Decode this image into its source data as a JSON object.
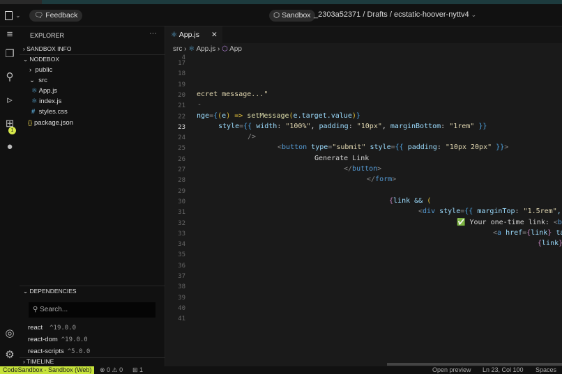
{
  "header": {
    "feedback": "Feedback",
    "sandbox": "Sandbox",
    "path": "_2303a52371 / Drafts / ecstatic-hoover-nyttv4"
  },
  "activity": {
    "badge": "1"
  },
  "explorer": {
    "title": "EXPLORER",
    "more": "···",
    "sandbox_info": "SANDBOX INFO",
    "nodebox": "NODEBOX",
    "tree": [
      {
        "label": "public",
        "kind": "folder"
      },
      {
        "label": "src",
        "kind": "folder-open"
      },
      {
        "label": "App.js",
        "kind": "react"
      },
      {
        "label": "index.js",
        "kind": "react"
      },
      {
        "label": "styles.css",
        "kind": "css"
      },
      {
        "label": "package.json",
        "kind": "json"
      }
    ],
    "dependencies": "DEPENDENCIES",
    "search_placeholder": "Search...",
    "deps": [
      {
        "name": "react",
        "version": "^19.0.0"
      },
      {
        "name": "react-dom",
        "version": "^19.0.0"
      },
      {
        "name": "react-scripts",
        "version": "^5.0.0"
      }
    ],
    "timeline": "TIMELINE"
  },
  "editor": {
    "tab": "App.js",
    "breadcrumbs": [
      "src",
      "App.js",
      "App"
    ],
    "line_numbers": [
      "4",
      "17",
      "18",
      "19",
      "20",
      "21",
      "22",
      "23",
      "24",
      "25",
      "26",
      "27",
      "28",
      "29",
      "30",
      "31",
      "32",
      "33",
      "34",
      "35",
      "36",
      "37",
      "38",
      "39",
      "40",
      "41"
    ],
    "current_line": "23",
    "lines": [
      {
        "ln": "20",
        "tokens": [
          {
            "t": "ecret message...\"",
            "c": "str"
          }
        ]
      },
      {
        "ln": "21",
        "tokens": [
          {
            "t": "-",
            "c": "punc"
          }
        ]
      },
      {
        "ln": "22",
        "tokens": [
          {
            "t": "nge",
            "c": "attr"
          },
          {
            "t": "=",
            "c": "punc"
          },
          {
            "t": "{",
            "c": "br3"
          },
          {
            "t": "(",
            "c": "br"
          },
          {
            "t": "e",
            "c": "attr"
          },
          {
            "t": ") => ",
            "c": "br"
          },
          {
            "t": "setMessage",
            "c": "fn"
          },
          {
            "t": "(",
            "c": "br"
          },
          {
            "t": "e.target.value",
            "c": "attr"
          },
          {
            "t": ")",
            "c": "br"
          },
          {
            "t": "}",
            "c": "br3"
          }
        ]
      },
      {
        "ln": "23",
        "tokens": [
          {
            "t": "style",
            "c": "attr"
          },
          {
            "t": "=",
            "c": "punc"
          },
          {
            "t": "{{ ",
            "c": "br3"
          },
          {
            "t": "width",
            "c": "attr"
          },
          {
            "t": ": ",
            "c": "txt"
          },
          {
            "t": "\"100%\"",
            "c": "str"
          },
          {
            "t": ", ",
            "c": "txt"
          },
          {
            "t": "padding",
            "c": "attr"
          },
          {
            "t": ": ",
            "c": "txt"
          },
          {
            "t": "\"10px\"",
            "c": "str"
          },
          {
            "t": ", ",
            "c": "txt"
          },
          {
            "t": "marginBottom",
            "c": "attr"
          },
          {
            "t": ": ",
            "c": "txt"
          },
          {
            "t": "\"1rem\"",
            "c": "str"
          },
          {
            "t": " }}",
            "c": "br3"
          }
        ]
      },
      {
        "ln": "24",
        "tokens": [
          {
            "t": "/>",
            "c": "punc"
          }
        ]
      },
      {
        "ln": "25",
        "tokens": [
          {
            "t": "<",
            "c": "punc"
          },
          {
            "t": "button",
            "c": "tag"
          },
          {
            "t": " type",
            "c": "attr"
          },
          {
            "t": "=",
            "c": "punc"
          },
          {
            "t": "\"submit\"",
            "c": "str"
          },
          {
            "t": " style",
            "c": "attr"
          },
          {
            "t": "=",
            "c": "punc"
          },
          {
            "t": "{{ ",
            "c": "br3"
          },
          {
            "t": "padding",
            "c": "attr"
          },
          {
            "t": ": ",
            "c": "txt"
          },
          {
            "t": "\"10px 20px\"",
            "c": "str"
          },
          {
            "t": " }}",
            "c": "br3"
          },
          {
            "t": ">",
            "c": "punc"
          }
        ]
      },
      {
        "ln": "26",
        "tokens": [
          {
            "t": "Generate Link",
            "c": "txt"
          }
        ]
      },
      {
        "ln": "27",
        "tokens": [
          {
            "t": "</",
            "c": "punc"
          },
          {
            "t": "button",
            "c": "tag"
          },
          {
            "t": ">",
            "c": "punc"
          }
        ]
      },
      {
        "ln": "28",
        "tokens": [
          {
            "t": "</",
            "c": "punc"
          },
          {
            "t": "form",
            "c": "tag"
          },
          {
            "t": ">",
            "c": "punc"
          }
        ]
      },
      {
        "ln": "30",
        "tokens": [
          {
            "t": "{",
            "c": "br2"
          },
          {
            "t": "link && ",
            "c": "attr"
          },
          {
            "t": "(",
            "c": "br"
          }
        ]
      },
      {
        "ln": "31",
        "tokens": [
          {
            "t": "<",
            "c": "punc"
          },
          {
            "t": "div",
            "c": "tag"
          },
          {
            "t": " style",
            "c": "attr"
          },
          {
            "t": "=",
            "c": "punc"
          },
          {
            "t": "{{ ",
            "c": "br3"
          },
          {
            "t": "marginTop",
            "c": "attr"
          },
          {
            "t": ": ",
            "c": "txt"
          },
          {
            "t": "\"1.5rem\"",
            "c": "str"
          },
          {
            "t": ", colo",
            "c": "attr"
          }
        ]
      },
      {
        "ln": "32",
        "tokens": [
          {
            "t": "✅",
            "c": "txt"
          },
          {
            "t": " Your one-time link: ",
            "c": "txt"
          },
          {
            "t": "<",
            "c": "punc"
          },
          {
            "t": "br",
            "c": "tag"
          },
          {
            "t": " /",
            "c": "punc"
          }
        ]
      },
      {
        "ln": "33",
        "tokens": [
          {
            "t": "<",
            "c": "punc"
          },
          {
            "t": "a",
            "c": "tag"
          },
          {
            "t": " href",
            "c": "attr"
          },
          {
            "t": "=",
            "c": "punc"
          },
          {
            "t": "{",
            "c": "br2"
          },
          {
            "t": "link",
            "c": "attr"
          },
          {
            "t": "}",
            "c": "br2"
          },
          {
            "t": " targ",
            "c": "attr"
          }
        ]
      },
      {
        "ln": "34",
        "tokens": [
          {
            "t": "{",
            "c": "br2"
          },
          {
            "t": "link",
            "c": "attr"
          },
          {
            "t": "}",
            "c": "br2"
          }
        ]
      }
    ]
  },
  "status": {
    "left": "CodeSandbox - Sandbox (Web)",
    "problems": "⊗ 0 ⚠ 0",
    "ports": "1",
    "preview": "Open preview",
    "position": "Ln 23, Col 100",
    "spaces": "Spaces"
  }
}
